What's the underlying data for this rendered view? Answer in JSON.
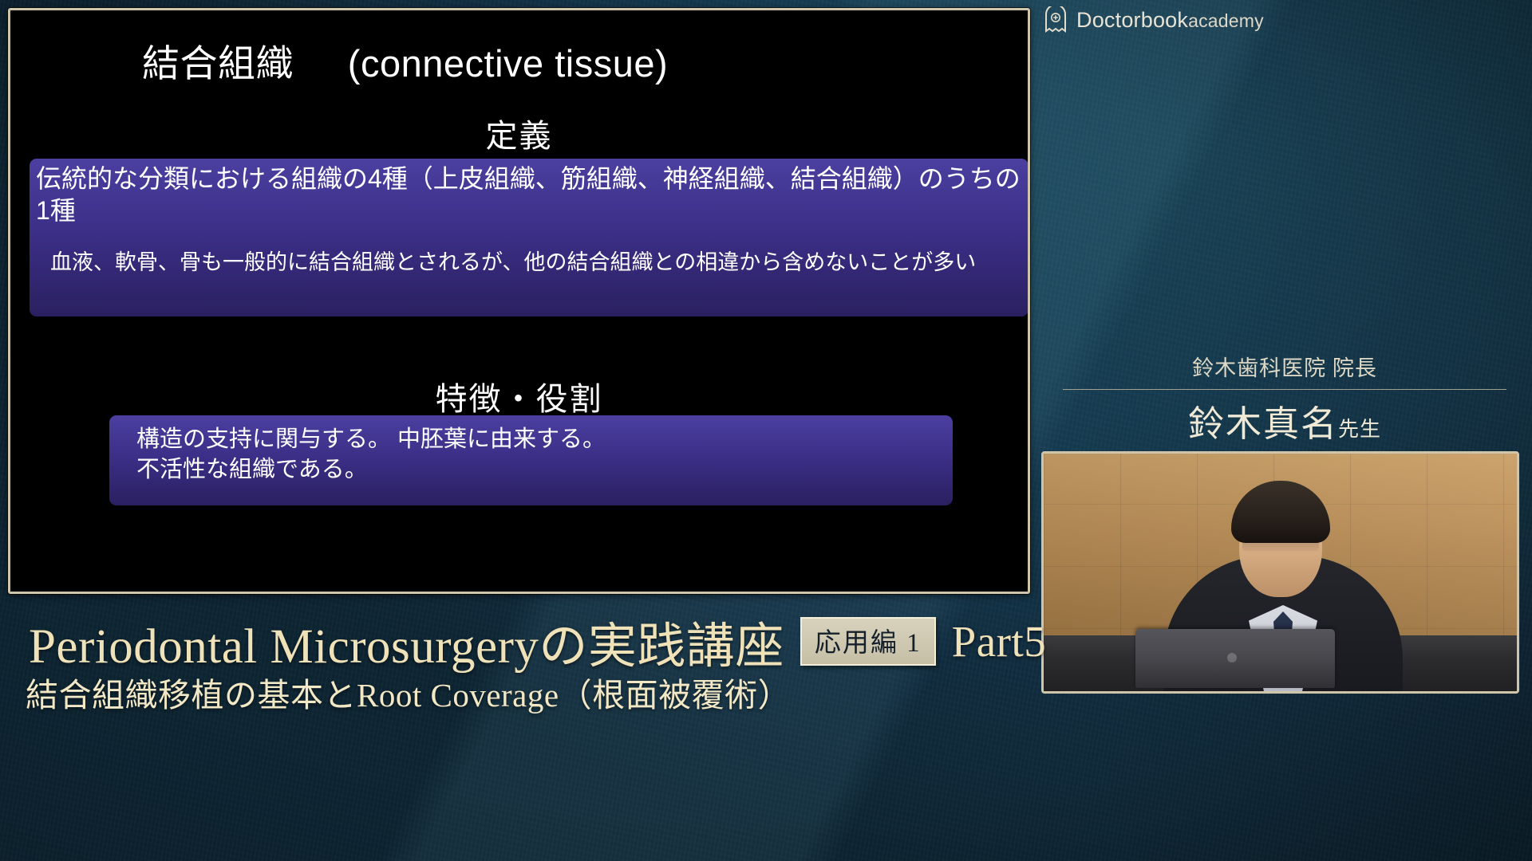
{
  "brand": {
    "icon": "book-plus-icon",
    "name": "Doctorbook",
    "suffix": "academy"
  },
  "slide": {
    "title_ja": "結合組織",
    "title_en": "(connective tissue)",
    "sections": [
      {
        "heading": "定義",
        "lines": [
          "伝統的な分類における組織の4種（上皮組織、筋組織、神経組織、結合組織）のうちの1種",
          "血液、軟骨、骨も一般的に結合組織とされるが、他の結合組織との相違から含めないことが多い"
        ]
      },
      {
        "heading": "特徴・役割",
        "lines": [
          "構造の支持に関与する。 中胚葉に由来する。",
          "不活性な組織である。"
        ]
      }
    ]
  },
  "presenter": {
    "affiliation": "鈴木歯科医院 院長",
    "name": "鈴木真名",
    "honorific": "先生"
  },
  "webcam": {
    "label": "presenter-video"
  },
  "course": {
    "title_en": "Periodontal Microsurgery",
    "title_ja": "の実践講座",
    "badge": "応用編 1",
    "part": "Part5",
    "subtitle": "結合組織移植の基本とRoot Coverage（根面被覆術）"
  },
  "colors": {
    "frame_border": "#cfc5ab",
    "highlight_box": "#3b2e86",
    "title_gold": "#f0e2b8",
    "backdrop_navy": "#173f55"
  }
}
